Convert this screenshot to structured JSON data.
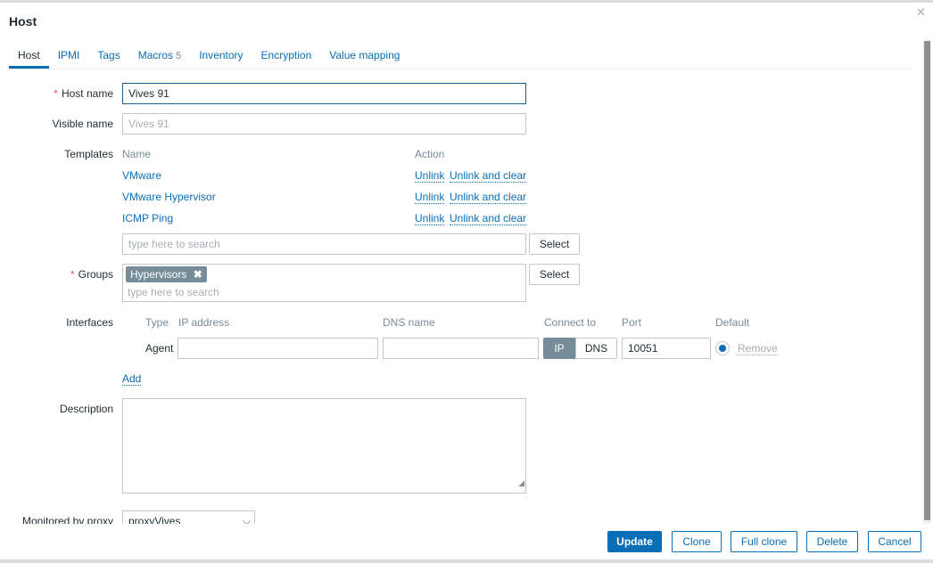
{
  "dialog": {
    "title": "Host",
    "close_icon": "close-icon"
  },
  "tabs": [
    {
      "label": "Host"
    },
    {
      "label": "IPMI"
    },
    {
      "label": "Tags"
    },
    {
      "label": "Macros",
      "count": "5"
    },
    {
      "label": "Inventory"
    },
    {
      "label": "Encryption"
    },
    {
      "label": "Value mapping"
    }
  ],
  "form": {
    "host_name_label": "Host name",
    "host_name": "Vives 91",
    "visible_name_label": "Visible name",
    "visible_name_placeholder": "Vives 91",
    "templates_label": "Templates",
    "templates_col_name": "Name",
    "templates_col_action": "Action",
    "templates": [
      {
        "name": "VMware"
      },
      {
        "name": "VMware Hypervisor"
      },
      {
        "name": "ICMP Ping"
      }
    ],
    "unlink": "Unlink",
    "unlink_clear": "Unlink and clear",
    "search_placeholder": "type here to search",
    "select": "Select",
    "groups_label": "Groups",
    "group_chip": "Hypervisors",
    "interfaces_label": "Interfaces",
    "if_cols": {
      "type": "Type",
      "ip": "IP address",
      "dns": "DNS name",
      "connect": "Connect to",
      "port": "Port",
      "default": "Default"
    },
    "if_type": "Agent",
    "ip_btn": "IP",
    "dns_btn": "DNS",
    "port": "10051",
    "remove": "Remove",
    "add": "Add",
    "description_label": "Description",
    "proxy_label": "Monitored by proxy",
    "proxy_value": "proxyVives"
  },
  "footer": {
    "update": "Update",
    "clone": "Clone",
    "full_clone": "Full clone",
    "delete": "Delete",
    "cancel": "Cancel"
  }
}
